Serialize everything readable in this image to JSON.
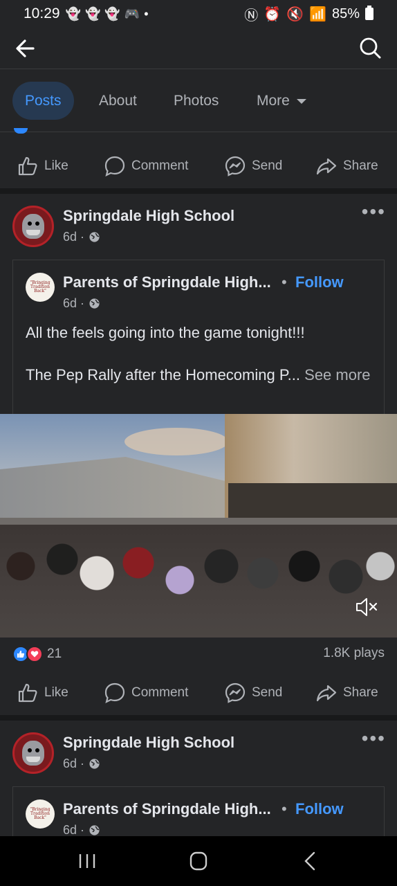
{
  "status_bar": {
    "time": "10:29",
    "notif_icons": [
      "snapchat-icon",
      "snapchat-icon",
      "snapchat-icon",
      "discord-icon"
    ],
    "dot": "•",
    "battery": "85%"
  },
  "tabs": {
    "posts": "Posts",
    "about": "About",
    "photos": "Photos",
    "more": "More"
  },
  "action_bar": {
    "like": "Like",
    "comment": "Comment",
    "send": "Send",
    "share": "Share"
  },
  "post1": {
    "author": "Springdale High School",
    "time": "6d ·",
    "shared": {
      "avatar_text": "\"Bringing Tradition Back\"",
      "author": "Parents of Springdale High...",
      "bullet": "•",
      "follow": "Follow",
      "time": "6d ·"
    },
    "text_line1": "All the feels going into the game tonight!!!",
    "text_line2": "The Pep Rally after the Homecoming P...",
    "see": "See",
    "more": "more",
    "reactions_count": "21",
    "plays": "1.8K plays"
  },
  "post2": {
    "author": "Springdale High School",
    "time": "6d ·",
    "shared": {
      "avatar_text": "\"Bringing Tradition Back\"",
      "author": "Parents of Springdale High...",
      "bullet": "•",
      "follow": "Follow",
      "time": "6d ·"
    }
  },
  "colors": {
    "background": "#242527",
    "accent": "#4599ff",
    "active_tab_bg": "#263951",
    "text_primary": "#e4e6eb",
    "text_secondary": "#b0b3b8",
    "like_blue": "#2d88ff",
    "love_red": "#f33e58"
  }
}
